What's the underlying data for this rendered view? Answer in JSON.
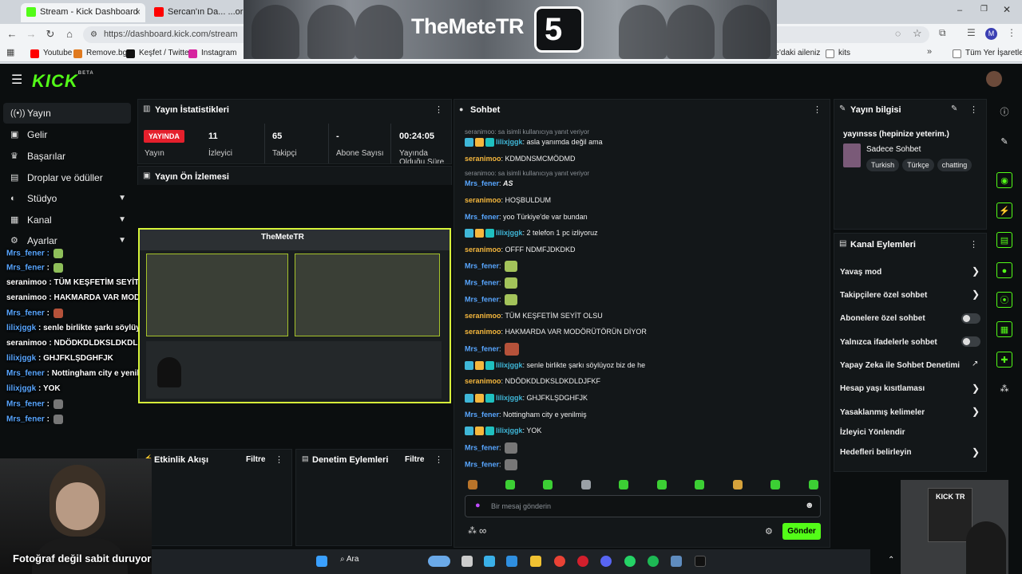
{
  "browser": {
    "tabs": [
      {
        "title": "Stream - Kick Dashboard",
        "favicon_color": "#53fc18"
      },
      {
        "title": "Sercan'ın Da... ...ormansı",
        "favicon_color": "#ff0000"
      }
    ],
    "url": "https://dashboard.kick.com/stream",
    "bookmarks": [
      "Youtube",
      "Remove.bg",
      "Keşfet / Twitter",
      "Instagram"
    ],
    "bookmarks_right": [
      "ile'daki aileniz",
      "kits",
      "Tüm Yer İşaretleri"
    ],
    "profile_initial": "M"
  },
  "banner": {
    "title": "TheMeteTR",
    "logo_char": "5"
  },
  "header": {
    "logo": "KICK",
    "logo_sup": "BETA"
  },
  "sidebar": {
    "items": [
      {
        "label": "Yayın",
        "icon": "broadcast-icon"
      },
      {
        "label": "Gelir",
        "icon": "money-icon"
      },
      {
        "label": "Başarılar",
        "icon": "trophy-icon"
      },
      {
        "label": "Droplar ve ödüller",
        "icon": "gift-icon"
      },
      {
        "label": "Stüdyo",
        "icon": "studio-icon"
      },
      {
        "label": "Kanal",
        "icon": "channel-icon"
      },
      {
        "label": "Ayarlar",
        "icon": "gear-icon"
      }
    ]
  },
  "overlay_chat": [
    {
      "user": "Mrs_fener",
      "text": "",
      "emote": true
    },
    {
      "user": "Mrs_fener",
      "text": "",
      "emote": true
    },
    {
      "user": "seranimoo",
      "text": "TÜM KEŞFETİM SEYİT OLSU"
    },
    {
      "user": "seranimoo",
      "text": "HAKMARDA VAR MODÖRÜTÖRÜN DİYOR"
    },
    {
      "user": "Mrs_fener",
      "text": "",
      "emote": true
    },
    {
      "user": "lilixjggk",
      "text": "senle birlikte şarkı söylüyoz biz de he"
    },
    {
      "user": "seranimoo",
      "text": "NDÖDKDLDKSLDKDLDJFKF"
    },
    {
      "user": "lilixjggk",
      "text": "GHJFKLŞDGHFJK"
    },
    {
      "user": "Mrs_fener",
      "text": "Nottingham city e yenilmiş"
    },
    {
      "user": "lilixjggk",
      "text": "YOK"
    },
    {
      "user": "Mrs_fener",
      "text": "",
      "emote": true
    },
    {
      "user": "Mrs_fener",
      "text": "",
      "emote": true
    }
  ],
  "stats": {
    "title": "Yayın İstatistikleri",
    "live_label": "YAYINDA",
    "stream_label": "Yayın",
    "viewers": "11",
    "viewers_label": "İzleyici",
    "followers": "65",
    "followers_label": "Takipçi",
    "subs": "-",
    "subs_label": "Abone Sayısı",
    "uptime": "00:24:05",
    "uptime_label": "Yayında Olduğu Süre"
  },
  "preview": {
    "title": "Yayın Ön İzlemesi"
  },
  "activity": {
    "title": "Etkinlik Akışı",
    "filter": "Filtre"
  },
  "moderation": {
    "title": "Denetim Eylemleri",
    "filter": "Filtre"
  },
  "chat": {
    "title": "Sohbet",
    "messages": [
      {
        "reply": "seranimoo: sa isimli kullanıcıya yanıt veriyor"
      },
      {
        "user": "lilixjggk",
        "color": "cyan",
        "badges": true,
        "text": "asla yanımda değil ama"
      },
      {
        "user": "seranimoo",
        "color": "gold",
        "text": "KDMDNSMCMÖDMD"
      },
      {
        "reply": "seranimoo: sa isimli kullanıcıya yanıt veriyor"
      },
      {
        "user": "Mrs_fener",
        "color": "blue",
        "text": "AS"
      },
      {
        "user": "seranimoo",
        "color": "gold",
        "text": "HOŞBULDUM"
      },
      {
        "user": "Mrs_fener",
        "color": "blue",
        "text": "yoo Türkiye'de var bundan"
      },
      {
        "user": "lilixjggk",
        "color": "cyan",
        "badges": true,
        "text": "2 telefon 1 pc izliyoruz"
      },
      {
        "user": "seranimoo",
        "color": "gold",
        "text": "OFFF NDMFJDKDKD"
      },
      {
        "user": "Mrs_fener",
        "color": "blue",
        "text": "",
        "emote": true
      },
      {
        "user": "Mrs_fener",
        "color": "blue",
        "text": "",
        "emote": true
      },
      {
        "user": "Mrs_fener",
        "color": "blue",
        "text": "",
        "emote": true
      },
      {
        "user": "seranimoo",
        "color": "gold",
        "text": "TÜM KEŞFETİM SEYİT OLSU"
      },
      {
        "user": "seranimoo",
        "color": "gold",
        "text": "HAKMARDA VAR MODÖRÜTÖRÜN DİYOR"
      },
      {
        "user": "Mrs_fener",
        "color": "blue",
        "text": "",
        "emote": true
      },
      {
        "user": "lilixjggk",
        "color": "cyan",
        "badges": true,
        "text": "senle birlikte şarkı söylüyoz biz de he"
      },
      {
        "user": "seranimoo",
        "color": "gold",
        "text": "NDÖDKDLDKSLDKDLDJFKF"
      },
      {
        "user": "lilixjggk",
        "color": "cyan",
        "badges": true,
        "text": "GHJFKLŞDGHFJK"
      },
      {
        "user": "Mrs_fener",
        "color": "blue",
        "text": "Nottingham city e yenilmiş"
      },
      {
        "user": "lilixjggk",
        "color": "cyan",
        "badges": true,
        "text": "YOK"
      },
      {
        "user": "Mrs_fener",
        "color": "blue",
        "text": "",
        "emote": true
      },
      {
        "user": "Mrs_fener",
        "color": "blue",
        "text": "",
        "emote": true
      }
    ],
    "placeholder": "Bir mesaj gönderin",
    "send": "Gönder",
    "extra": "∞"
  },
  "stream_info": {
    "title": "Yayın bilgisi",
    "stream_title": "yayınsss (hepinize yeterim.)",
    "category": "Sadece Sohbet",
    "tags": [
      "Turkish",
      "Türkçe",
      "chatting"
    ]
  },
  "channel_actions": {
    "title": "Kanal Eylemleri",
    "items": [
      {
        "label": "Yavaş mod",
        "kind": "chevron"
      },
      {
        "label": "Takipçilere özel sohbet",
        "kind": "chevron"
      },
      {
        "label": "Abonelere özel sohbet",
        "kind": "toggle"
      },
      {
        "label": "Yalnızca ifadelerle sohbet",
        "kind": "toggle"
      },
      {
        "label": "Yapay Zeka ile Sohbet Denetimi",
        "kind": "external"
      },
      {
        "label": "Hesap yaşı kısıtlaması",
        "kind": "chevron"
      },
      {
        "label": "Yasaklanmış kelimeler",
        "kind": "chevron"
      },
      {
        "label": "İzleyici Yönlendir",
        "kind": "none"
      },
      {
        "label": "Hedefleri belirleyin",
        "kind": "chevron"
      }
    ]
  },
  "taskbar": {
    "search": "Ara"
  },
  "webcam": {
    "caption": "Fotoğraf değil sabit duruyorum"
  },
  "kicktr": {
    "label": "KICK TR"
  },
  "colors": {
    "accent": "#53fc18",
    "live": "#e5202c",
    "preview_border": "#d7f53a"
  }
}
